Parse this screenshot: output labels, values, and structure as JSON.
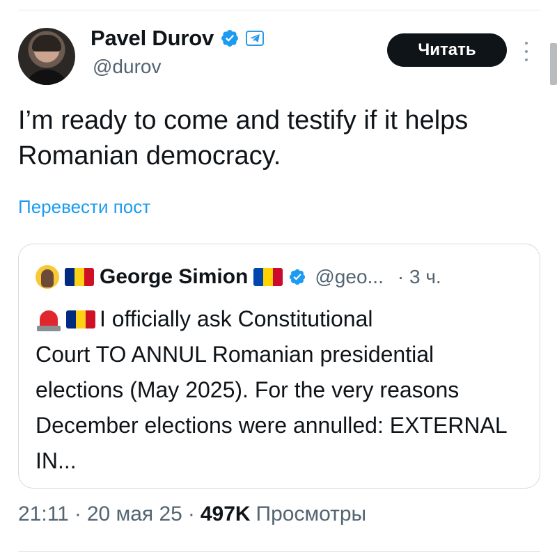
{
  "author": {
    "name": "Pavel Durov",
    "handle": "@durov",
    "verified_icon": "verified-badge-icon",
    "extra_icon": "telegram-icon"
  },
  "follow_button": "Читать",
  "tweet": {
    "text": "I’m ready to come and testify if it helps Romanian democracy.",
    "translate_link": "Перевести пост"
  },
  "quote": {
    "name": "George Simion",
    "handle": "@geo...",
    "time": "· 3 ч.",
    "line1": "I officially ask Constitutional",
    "rest": "Court TO ANNUL Romanian presidential elections (May 2025). For the very reasons December elections were annulled: EXTERNAL IN...",
    "flag_romania_colors": [
      "#002b7f",
      "#fcd116",
      "#ce1126"
    ],
    "flag_moldova_colors": [
      "#0046ae",
      "#ffd200",
      "#cc092f"
    ]
  },
  "meta": {
    "time": "21:11",
    "sep1": "·",
    "date": "20 мая 25",
    "sep2": "·",
    "views": "497K",
    "views_label": "Просмотры"
  },
  "colors": {
    "accent": "#1d9bf0",
    "text": "#0f1419",
    "muted": "#536471"
  }
}
